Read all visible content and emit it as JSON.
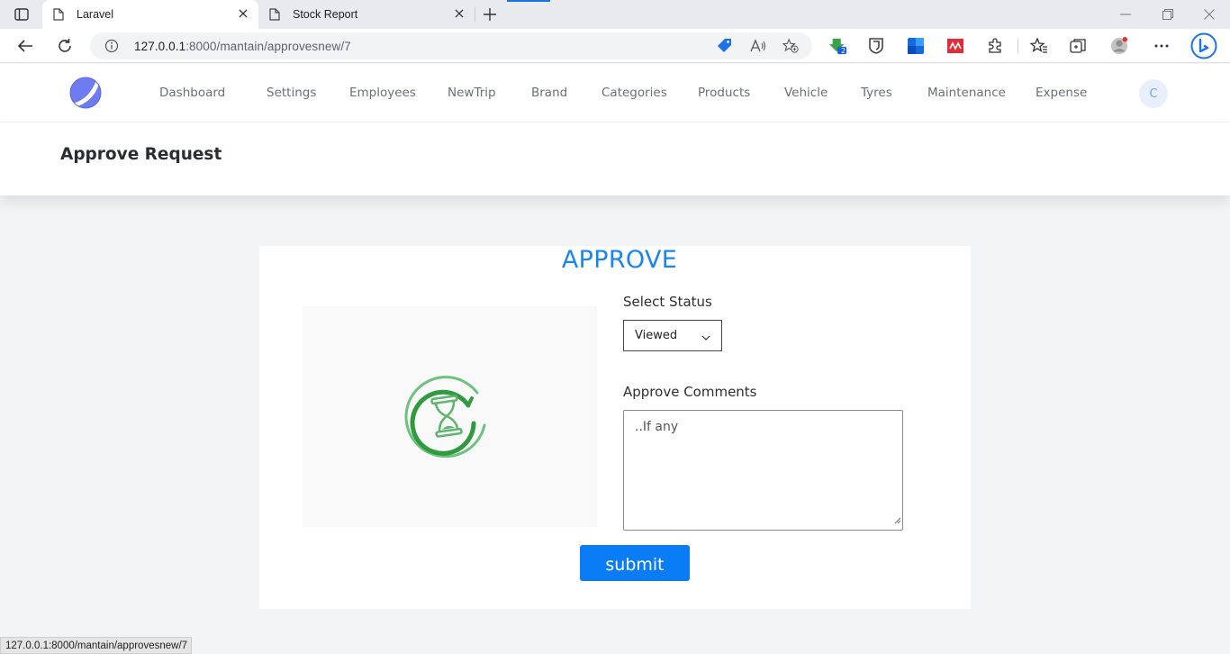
{
  "browser": {
    "tabs": [
      {
        "title": "Laravel",
        "active": true
      },
      {
        "title": "Stock Report",
        "active": false
      }
    ],
    "address": {
      "host": "127.0.0.1",
      "path": ":8000/mantain/approvesnew/7"
    },
    "extension_badge": "2",
    "status_url": "127.0.0.1:8000/mantain/approvesnew/7",
    "accent_color": "#1a73e8"
  },
  "app": {
    "nav_items": [
      "Dashboard",
      "Settings",
      "Employees",
      "NewTrip",
      "Brand",
      "Categories",
      "Products",
      "Vehicle",
      "Tyres",
      "Maintenance",
      "Expense"
    ],
    "avatar_initial": "C",
    "brand_color": "#5b67e6"
  },
  "page": {
    "title": "Approve Request"
  },
  "form": {
    "heading": "APPROVE",
    "status_label": "Select Status",
    "status_value": "Viewed",
    "comments_label": "Approve Comments",
    "comments_placeholder": "..If any",
    "submit_label": "submit",
    "illustration_icon": "hourglass-pending-icon",
    "submit_color": "#0a7cf5",
    "heading_color": "#1a85f0"
  }
}
